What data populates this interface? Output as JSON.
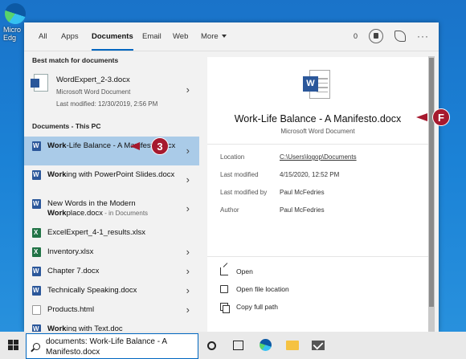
{
  "desktop": {
    "icon_label": "Micro\nEdg"
  },
  "tabs": {
    "items": [
      "All",
      "Apps",
      "Documents",
      "Email",
      "Web"
    ],
    "more": "More",
    "points": "0"
  },
  "left": {
    "best_match_header": "Best match for documents",
    "best_match": {
      "name": "WordExpert_2-3.docx",
      "type": "Microsoft Word Document",
      "modified": "Last modified: 12/30/2019, 2:56 PM"
    },
    "documents_header": "Documents - This PC",
    "items": [
      {
        "bold": "Work",
        "rest": "-Life Balance - A Manifesto.docx",
        "extra": "",
        "icon": "word"
      },
      {
        "bold": "Work",
        "rest": "ing with PowerPoint Slides.docx",
        "extra": "",
        "icon": "word"
      },
      {
        "pre": "New Words in the Modern ",
        "bold": "Work",
        "rest": "place.docx",
        "extra": " - in Documents",
        "icon": "word"
      },
      {
        "bold": "",
        "rest": "ExcelExpert_4-1_results.xlsx",
        "extra": "",
        "icon": "excel"
      },
      {
        "bold": "",
        "rest": "Inventory.xlsx",
        "extra": "",
        "icon": "excel"
      },
      {
        "bold": "",
        "rest": "Chapter 7.docx",
        "extra": "",
        "icon": "word"
      },
      {
        "bold": "",
        "rest": "Technically Speaking.docx",
        "extra": "",
        "icon": "word"
      },
      {
        "bold": "",
        "rest": "Products.html",
        "extra": "",
        "icon": "html"
      },
      {
        "bold": "Work",
        "rest": "ing with Text.doc",
        "extra": "",
        "icon": "word"
      }
    ]
  },
  "detail": {
    "title": "Work-Life Balance - A Manifesto.docx",
    "subtitle": "Microsoft Word Document",
    "location_label": "Location",
    "location_value": "C:\\Users\\logop\\Documents",
    "modified_label": "Last modified",
    "modified_value": "4/15/2020, 12:52 PM",
    "modified_by_label": "Last modified by",
    "modified_by_value": "Paul McFedries",
    "author_label": "Author",
    "author_value": "Paul McFedries",
    "actions": [
      "Open",
      "Open file location",
      "Copy full path"
    ]
  },
  "callouts": {
    "step": "3",
    "figure": "F"
  },
  "taskbar": {
    "search_query": "documents: Work-Life Balance - A Manifesto.docx"
  }
}
